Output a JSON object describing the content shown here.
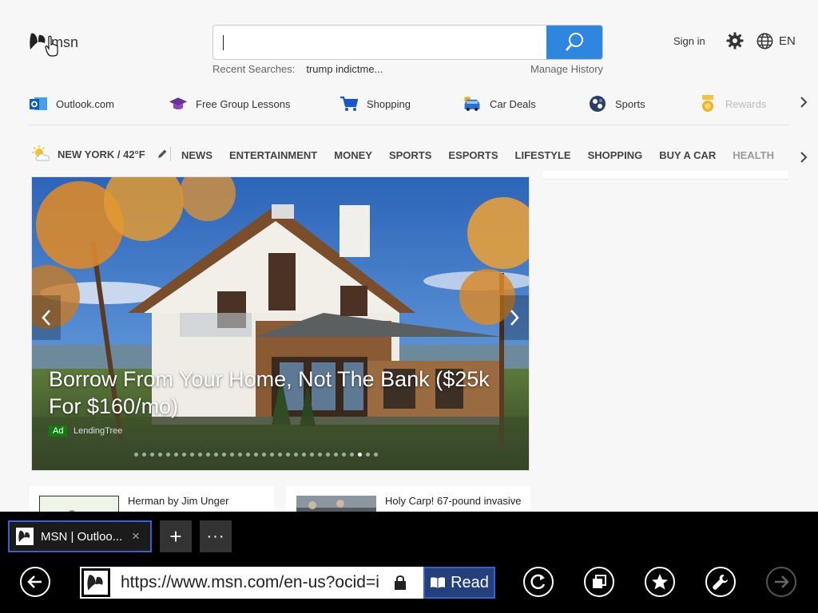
{
  "brand": {
    "name": "msn"
  },
  "search": {
    "value": "",
    "recent_label": "Recent Searches:",
    "recent_query": "trump indictme...",
    "manage_label": "Manage History"
  },
  "header": {
    "signin": "Sign in",
    "lang": "EN"
  },
  "quick_links": [
    {
      "label": "Outlook.com",
      "icon": "outlook-icon"
    },
    {
      "label": "Free Group Lessons",
      "icon": "graduation-cap-icon"
    },
    {
      "label": "Shopping",
      "icon": "cart-icon"
    },
    {
      "label": "Car Deals",
      "icon": "car-icon"
    },
    {
      "label": "Sports",
      "icon": "sports-ball-icon"
    },
    {
      "label": "Rewards",
      "icon": "medal-icon"
    }
  ],
  "weather": {
    "label": "NEW YORK / 42°F"
  },
  "nav": [
    "NEWS",
    "ENTERTAINMENT",
    "MONEY",
    "SPORTS",
    "ESPORTS",
    "LIFESTYLE",
    "SHOPPING",
    "BUY A CAR",
    "HEALTH"
  ],
  "hero": {
    "title": "Borrow From Your Home, Not The Bank ($25k For $160/mo)",
    "ad_badge": "Ad",
    "source": "LendingTree",
    "dot_count": 31,
    "active_dot": 28
  },
  "cards": [
    {
      "title": "Herman by Jim Unger"
    },
    {
      "title": "Holy Carp! 67-pound invasive"
    }
  ],
  "browser": {
    "tab_title": "MSN | Outloo...",
    "tab_close": "×",
    "new_tab": "+",
    "more": "···",
    "url": "https://www.msn.com/en-us?ocid=i",
    "read_label": "Read"
  },
  "colors": {
    "search_button": "#2f86de",
    "tab_border": "#3a5fcd",
    "read_bg": "#23407a",
    "ad_green": "#107c10"
  }
}
